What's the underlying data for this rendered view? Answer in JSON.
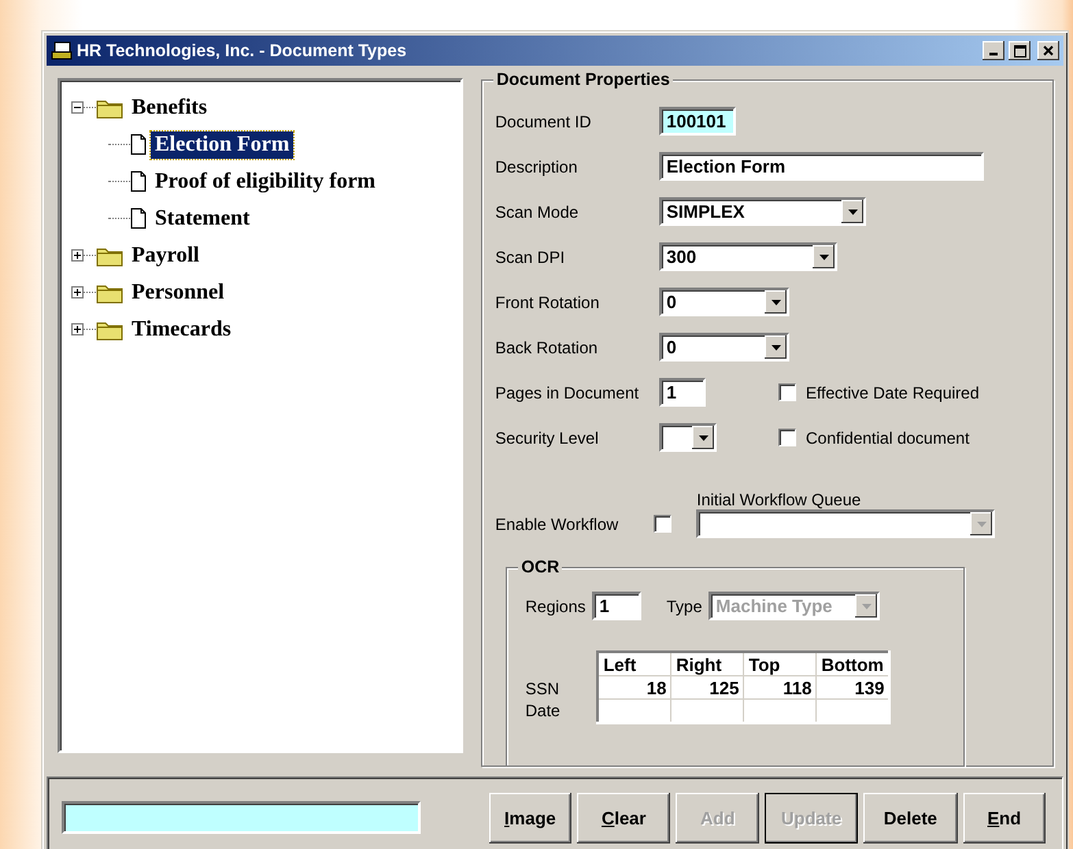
{
  "window": {
    "title": "HR Technologies, Inc. - Document Types"
  },
  "tree": [
    {
      "label": "Benefits",
      "kind": "folder",
      "expanded": true,
      "selected": false,
      "children": [
        {
          "label": "Election Form",
          "kind": "document",
          "selected": true
        },
        {
          "label": "Proof of eligibility form",
          "kind": "document",
          "selected": false
        },
        {
          "label": "Statement",
          "kind": "document",
          "selected": false
        }
      ]
    },
    {
      "label": "Payroll",
      "kind": "folder",
      "expanded": false,
      "selected": false
    },
    {
      "label": "Personnel",
      "kind": "folder",
      "expanded": false,
      "selected": false
    },
    {
      "label": "Timecards",
      "kind": "folder",
      "expanded": false,
      "selected": false
    }
  ],
  "properties": {
    "title": "Document Properties",
    "rows": [
      {
        "label": "Document ID",
        "kind": "text",
        "value": "100101",
        "highlighted": true
      },
      {
        "label": "Description",
        "kind": "text",
        "value": "Election Form",
        "highlighted": false
      },
      {
        "label": "Scan Mode",
        "kind": "dropdown",
        "value": "SIMPLEX"
      },
      {
        "label": "Scan DPI",
        "kind": "dropdown",
        "value": "300"
      },
      {
        "label": "Front Rotation",
        "kind": "dropdown",
        "value": "0"
      },
      {
        "label": "Back Rotation",
        "kind": "dropdown",
        "value": "0"
      },
      {
        "label": "Pages in Document",
        "kind": "text",
        "value": "1",
        "highlighted": false,
        "checkbox": {
          "label": "Effective Date Required",
          "checked": false
        }
      },
      {
        "label": "Security Level",
        "kind": "dropdown",
        "checkbox": {
          "label": "Confidential document",
          "checked": false
        }
      }
    ],
    "workflow": {
      "label": "Enable Workflow",
      "checked": false,
      "queue": {
        "label": "Initial Workflow Queue",
        "disabled": true
      }
    },
    "ocr": {
      "title": "OCR",
      "regions": {
        "label": "Regions",
        "value": "1"
      },
      "type": {
        "label": "Type",
        "value": "Machine Type",
        "disabled": true
      },
      "table": {
        "columns": [
          "Left",
          "Right",
          "Top",
          "Bottom"
        ],
        "rows": [
          {
            "label": "SSN",
            "cells": [
              "18",
              "125",
              "118",
              "139"
            ]
          },
          {
            "label": "Date"
          }
        ]
      }
    }
  },
  "footer": {
    "status_field": {
      "highlighted": true
    },
    "buttons": [
      {
        "accel": "I",
        "rest": "mage",
        "disabled": false,
        "default": false
      },
      {
        "accel": "C",
        "rest": "lear",
        "disabled": false,
        "default": false
      },
      {
        "rest": "Add",
        "disabled": true,
        "default": false
      },
      {
        "rest": "Update",
        "disabled": true,
        "default": true
      },
      {
        "rest": "Delete",
        "disabled": false,
        "default": false
      },
      {
        "accel": "E",
        "rest": "nd",
        "disabled": false,
        "default": false
      }
    ]
  }
}
